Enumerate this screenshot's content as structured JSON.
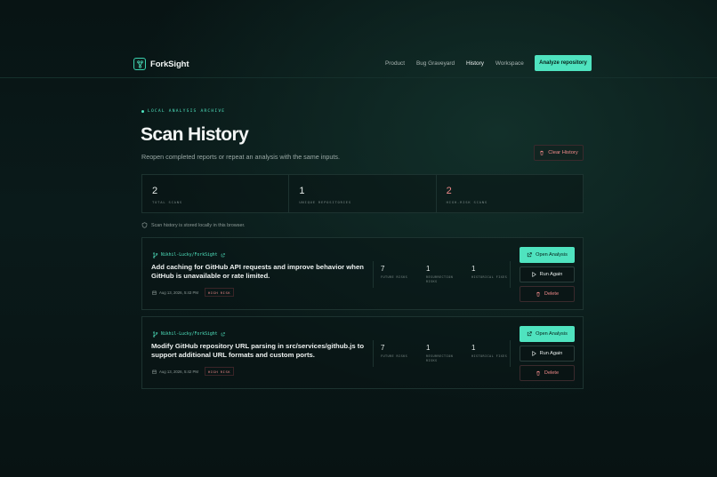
{
  "nav": {
    "logo_text": "ForkSight",
    "links": [
      "Product",
      "Bug Graveyard",
      "History",
      "Workspace"
    ],
    "active_index": 2,
    "cta_label": "Analyze repository"
  },
  "header": {
    "kicker": "LOCAL ANALYSIS ARCHIVE",
    "title": "Scan History",
    "subtitle": "Reopen completed reports or repeat an analysis with the same inputs.",
    "clear_label": "Clear History"
  },
  "stats": [
    {
      "value": "2",
      "label": "TOTAL SCANS"
    },
    {
      "value": "1",
      "label": "UNIQUE REPOSITORIES"
    },
    {
      "value": "2",
      "label": "HIGH-RISK SCANS"
    }
  ],
  "local_note": "Scan history is stored locally in this browser.",
  "scans": [
    {
      "repo": "Nikhil-Lucky/ForkSight",
      "title": "Add caching for GitHub API requests and improve behavior when GitHub is unavailable or rate limited.",
      "timestamp": "Aug 13, 2026, 5:43 PM",
      "badge": "HIGH RISK",
      "metrics": [
        {
          "value": "7",
          "label": "FUTURE RISKS"
        },
        {
          "value": "1",
          "label": "RESURRECTION RISKS"
        },
        {
          "value": "1",
          "label": "HISTORICAL FIXES"
        }
      ],
      "actions": {
        "open": "Open Analysis",
        "run": "Run Again",
        "delete": "Delete"
      }
    },
    {
      "repo": "Nikhil-Lucky/ForkSight",
      "title": "Modify GitHub repository URL parsing in src/services/github.js to support additional URL formats and custom ports.",
      "timestamp": "Aug 13, 2026, 5:42 PM",
      "badge": "HIGH RISK",
      "metrics": [
        {
          "value": "7",
          "label": "FUTURE RISKS"
        },
        {
          "value": "1",
          "label": "RESURRECTION RISKS"
        },
        {
          "value": "1",
          "label": "HISTORICAL FIXES"
        }
      ],
      "actions": {
        "open": "Open Analysis",
        "run": "Run Again",
        "delete": "Delete"
      }
    }
  ],
  "colors": {
    "accent": "#4fe3bf",
    "danger": "#f08a8a",
    "background": "#0a1a1a"
  }
}
